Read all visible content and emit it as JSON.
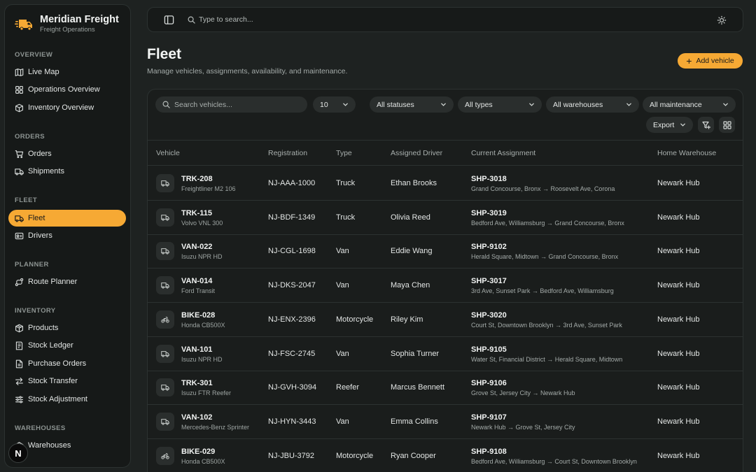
{
  "brand": {
    "name": "Meridian Freight",
    "subtitle": "Freight Operations",
    "logo_icon": "truck-icon"
  },
  "sidebar": {
    "sections": [
      {
        "label": "OVERVIEW",
        "items": [
          {
            "label": "Live Map",
            "icon": "map-icon"
          },
          {
            "label": "Operations Overview",
            "icon": "grid-icon"
          },
          {
            "label": "Inventory Overview",
            "icon": "box-icon"
          }
        ]
      },
      {
        "label": "ORDERS",
        "items": [
          {
            "label": "Orders",
            "icon": "cart-icon"
          },
          {
            "label": "Shipments",
            "icon": "truck-icon"
          }
        ]
      },
      {
        "label": "FLEET",
        "items": [
          {
            "label": "Fleet",
            "icon": "truck-icon",
            "active": true
          },
          {
            "label": "Drivers",
            "icon": "id-card-icon"
          }
        ]
      },
      {
        "label": "PLANNER",
        "items": [
          {
            "label": "Route Planner",
            "icon": "route-icon"
          }
        ]
      },
      {
        "label": "INVENTORY",
        "items": [
          {
            "label": "Products",
            "icon": "package-icon"
          },
          {
            "label": "Stock Ledger",
            "icon": "ledger-icon"
          },
          {
            "label": "Purchase Orders",
            "icon": "document-icon"
          },
          {
            "label": "Stock Transfer",
            "icon": "transfer-icon"
          },
          {
            "label": "Stock Adjustment",
            "icon": "sliders-icon"
          }
        ]
      },
      {
        "label": "WAREHOUSES",
        "items": [
          {
            "label": "Warehouses",
            "icon": "warehouse-icon"
          }
        ]
      }
    ],
    "bottom_badge": "N"
  },
  "topbar": {
    "search_placeholder": "Type to search..."
  },
  "header": {
    "title": "Fleet",
    "subtitle": "Manage vehicles, assignments, availability, and maintenance.",
    "add_button": "Add vehicle"
  },
  "filters": {
    "search_placeholder": "Search vehicles...",
    "page_size": "10",
    "status": "All statuses",
    "type": "All types",
    "warehouse": "All warehouses",
    "maintenance": "All maintenance",
    "export": "Export"
  },
  "table": {
    "columns": [
      "Vehicle",
      "Registration",
      "Type",
      "Assigned Driver",
      "Current Assignment",
      "Home Warehouse"
    ],
    "rows": [
      {
        "id": "TRK-208",
        "model": "Freightliner M2 106",
        "registration": "NJ-AAA-1000",
        "type": "Truck",
        "driver": "Ethan Brooks",
        "shipment": "SHP-3018",
        "route": "Grand Concourse, Bronx → Roosevelt Ave, Corona",
        "warehouse": "Newark Hub",
        "icon": "truck-icon"
      },
      {
        "id": "TRK-115",
        "model": "Volvo VNL 300",
        "registration": "NJ-BDF-1349",
        "type": "Truck",
        "driver": "Olivia Reed",
        "shipment": "SHP-3019",
        "route": "Bedford Ave, Williamsburg → Grand Concourse, Bronx",
        "warehouse": "Newark Hub",
        "icon": "truck-icon"
      },
      {
        "id": "VAN-022",
        "model": "Isuzu NPR HD",
        "registration": "NJ-CGL-1698",
        "type": "Van",
        "driver": "Eddie Wang",
        "shipment": "SHP-9102",
        "route": "Herald Square, Midtown → Grand Concourse, Bronx",
        "warehouse": "Newark Hub",
        "icon": "truck-icon"
      },
      {
        "id": "VAN-014",
        "model": "Ford Transit",
        "registration": "NJ-DKS-2047",
        "type": "Van",
        "driver": "Maya Chen",
        "shipment": "SHP-3017",
        "route": "3rd Ave, Sunset Park → Bedford Ave, Williamsburg",
        "warehouse": "Newark Hub",
        "icon": "truck-icon"
      },
      {
        "id": "BIKE-028",
        "model": "Honda CB500X",
        "registration": "NJ-ENX-2396",
        "type": "Motorcycle",
        "driver": "Riley Kim",
        "shipment": "SHP-3020",
        "route": "Court St, Downtown Brooklyn → 3rd Ave, Sunset Park",
        "warehouse": "Newark Hub",
        "icon": "bike-icon"
      },
      {
        "id": "VAN-101",
        "model": "Isuzu NPR HD",
        "registration": "NJ-FSC-2745",
        "type": "Van",
        "driver": "Sophia Turner",
        "shipment": "SHP-9105",
        "route": "Water St, Financial District → Herald Square, Midtown",
        "warehouse": "Newark Hub",
        "icon": "truck-icon"
      },
      {
        "id": "TRK-301",
        "model": "Isuzu FTR Reefer",
        "registration": "NJ-GVH-3094",
        "type": "Reefer",
        "driver": "Marcus Bennett",
        "shipment": "SHP-9106",
        "route": "Grove St, Jersey City → Newark Hub",
        "warehouse": "Newark Hub",
        "icon": "truck-icon"
      },
      {
        "id": "VAN-102",
        "model": "Mercedes-Benz Sprinter",
        "registration": "NJ-HYN-3443",
        "type": "Van",
        "driver": "Emma Collins",
        "shipment": "SHP-9107",
        "route": "Newark Hub → Grove St, Jersey City",
        "warehouse": "Newark Hub",
        "icon": "truck-icon"
      },
      {
        "id": "BIKE-029",
        "model": "Honda CB500X",
        "registration": "NJ-JBU-3792",
        "type": "Motorcycle",
        "driver": "Ryan Cooper",
        "shipment": "SHP-9108",
        "route": "Bedford Ave, Williamsburg → Court St, Downtown Brooklyn",
        "warehouse": "Newark Hub",
        "icon": "bike-icon"
      }
    ]
  },
  "colors": {
    "accent": "#f6a934",
    "background": "#1e2221",
    "panel": "#1a1d1c",
    "border": "#2c3231"
  }
}
